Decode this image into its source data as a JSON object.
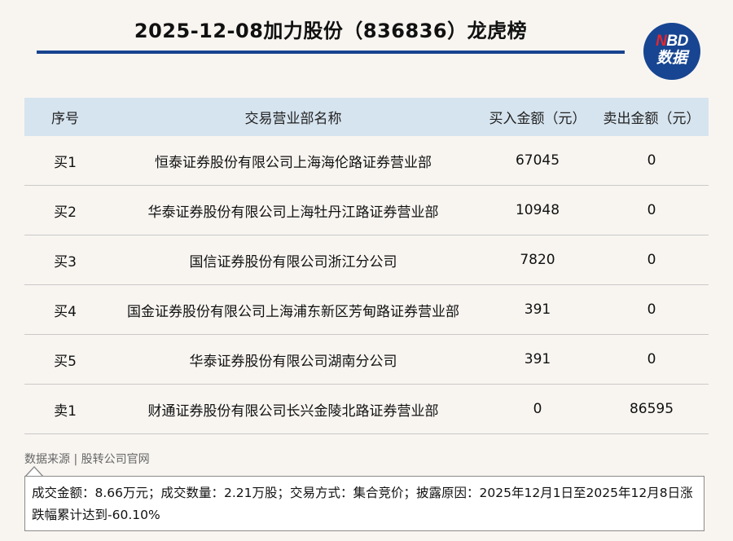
{
  "title": "2025-12-08加力股份（836836）龙虎榜",
  "logo": {
    "line1_n": "N",
    "line1_rest": "BD",
    "line2": "数据"
  },
  "table": {
    "headers": [
      "序号",
      "交易营业部名称",
      "买入金额（元）",
      "卖出金额（元）"
    ],
    "rows": [
      {
        "seq": "买1",
        "name": "恒泰证券股份有限公司上海海伦路证券营业部",
        "buy": "67045",
        "sell": "0"
      },
      {
        "seq": "买2",
        "name": "华泰证券股份有限公司上海牡丹江路证券营业部",
        "buy": "10948",
        "sell": "0"
      },
      {
        "seq": "买3",
        "name": "国信证券股份有限公司浙江分公司",
        "buy": "7820",
        "sell": "0"
      },
      {
        "seq": "买4",
        "name": "国金证券股份有限公司上海浦东新区芳甸路证券营业部",
        "buy": "391",
        "sell": "0"
      },
      {
        "seq": "买5",
        "name": "华泰证券股份有限公司湖南分公司",
        "buy": "391",
        "sell": "0"
      },
      {
        "seq": "卖1",
        "name": "财通证券股份有限公司长兴金陵北路证券营业部",
        "buy": "0",
        "sell": "86595"
      }
    ]
  },
  "source": "数据来源 | 股转公司官网",
  "note": "成交金额：8.66万元；成交数量：2.21万股；交易方式：集合竞价；披露原因：2025年12月1日至2025年12月8日涨跌幅累计达到-60.10%",
  "colors": {
    "accent": "#17438f",
    "header_bg": "#d6e4ef",
    "logo_red": "#e8252b",
    "page_bg": "#f8f5f1"
  }
}
